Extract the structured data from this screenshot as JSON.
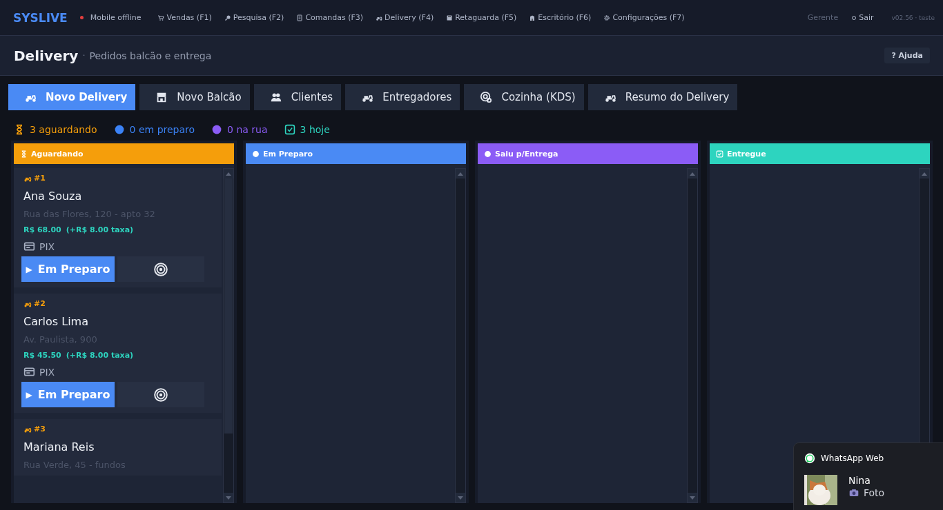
{
  "topbar": {
    "brand": "SYSLIVE",
    "status": {
      "label": "Mobile offline",
      "color": "#e53e3e"
    },
    "nav": [
      {
        "kind": "cart",
        "label": "Vendas (F1)"
      },
      {
        "kind": "search",
        "label": "Pesquisa (F2)"
      },
      {
        "kind": "list",
        "label": "Comandas (F3)"
      },
      {
        "kind": "scooter",
        "label": "Delivery (F4)"
      },
      {
        "kind": "save",
        "label": "Retaguarda (F5)"
      },
      {
        "kind": "building",
        "label": "Escritório (F6)"
      },
      {
        "kind": "gear",
        "label": "Configurações (F7)"
      }
    ],
    "user": "Gerente",
    "logout": "Sair",
    "version": "v02.56 · teste"
  },
  "header": {
    "title": "Delivery",
    "separator": "·",
    "subtitle": "Pedidos balcão e entrega",
    "help": "? Ajuda"
  },
  "tabs": [
    {
      "kind": "scooter",
      "label": "Novo Delivery",
      "selected": true
    },
    {
      "kind": "store",
      "label": "Novo Balcão",
      "selected": false
    },
    {
      "kind": "users",
      "label": "Clientes",
      "selected": false
    },
    {
      "kind": "scooter",
      "label": "Entregadores",
      "selected": false
    },
    {
      "kind": "target",
      "label": "Cozinha (KDS)",
      "selected": false
    },
    {
      "kind": "scooter",
      "label": "Resumo do Delivery",
      "selected": false
    }
  ],
  "summary": [
    {
      "kind": "hourglass",
      "label": "3 aguardando",
      "color": "#f59e0b"
    },
    {
      "kind": "dot",
      "label": "0 em preparo",
      "color": "#3b82f6"
    },
    {
      "kind": "dot",
      "label": "0 na rua",
      "color": "#8b5cf6"
    },
    {
      "kind": "check",
      "label": "3 hoje",
      "color": "#2dd4bf"
    }
  ],
  "lanes": [
    {
      "kind": "hourglass",
      "title": "Aguardando",
      "color": "#f59e0b",
      "orders": [
        {
          "number": "#1",
          "name": "Ana Souza",
          "address": "Rua das Flores, 120 - apto 32",
          "total": "R$ 68.00",
          "fee": "(+R$ 8.00 taxa)",
          "payment": "PIX",
          "action": "Em Preparo",
          "action_icon": "▶"
        },
        {
          "number": "#2",
          "name": "Carlos Lima",
          "address": "Av. Paulista, 900",
          "total": "R$ 45.50",
          "fee": "(+R$ 8.00 taxa)",
          "payment": "PIX",
          "action": "Em Preparo",
          "action_icon": "▶"
        },
        {
          "number": "#3",
          "name": "Mariana Reis",
          "address": "Rua Verde, 45 - fundos"
        }
      ]
    },
    {
      "kind": "dot",
      "title": "Em Preparo",
      "color": "#4a8af4"
    },
    {
      "kind": "dot",
      "title": "Saiu p/Entrega",
      "color": "#8b5cf6"
    },
    {
      "kind": "check",
      "title": "Entregue",
      "color": "#2dd4bf"
    }
  ],
  "notification": {
    "app": "WhatsApp Web",
    "sender": "Nina",
    "message": "Foto"
  }
}
